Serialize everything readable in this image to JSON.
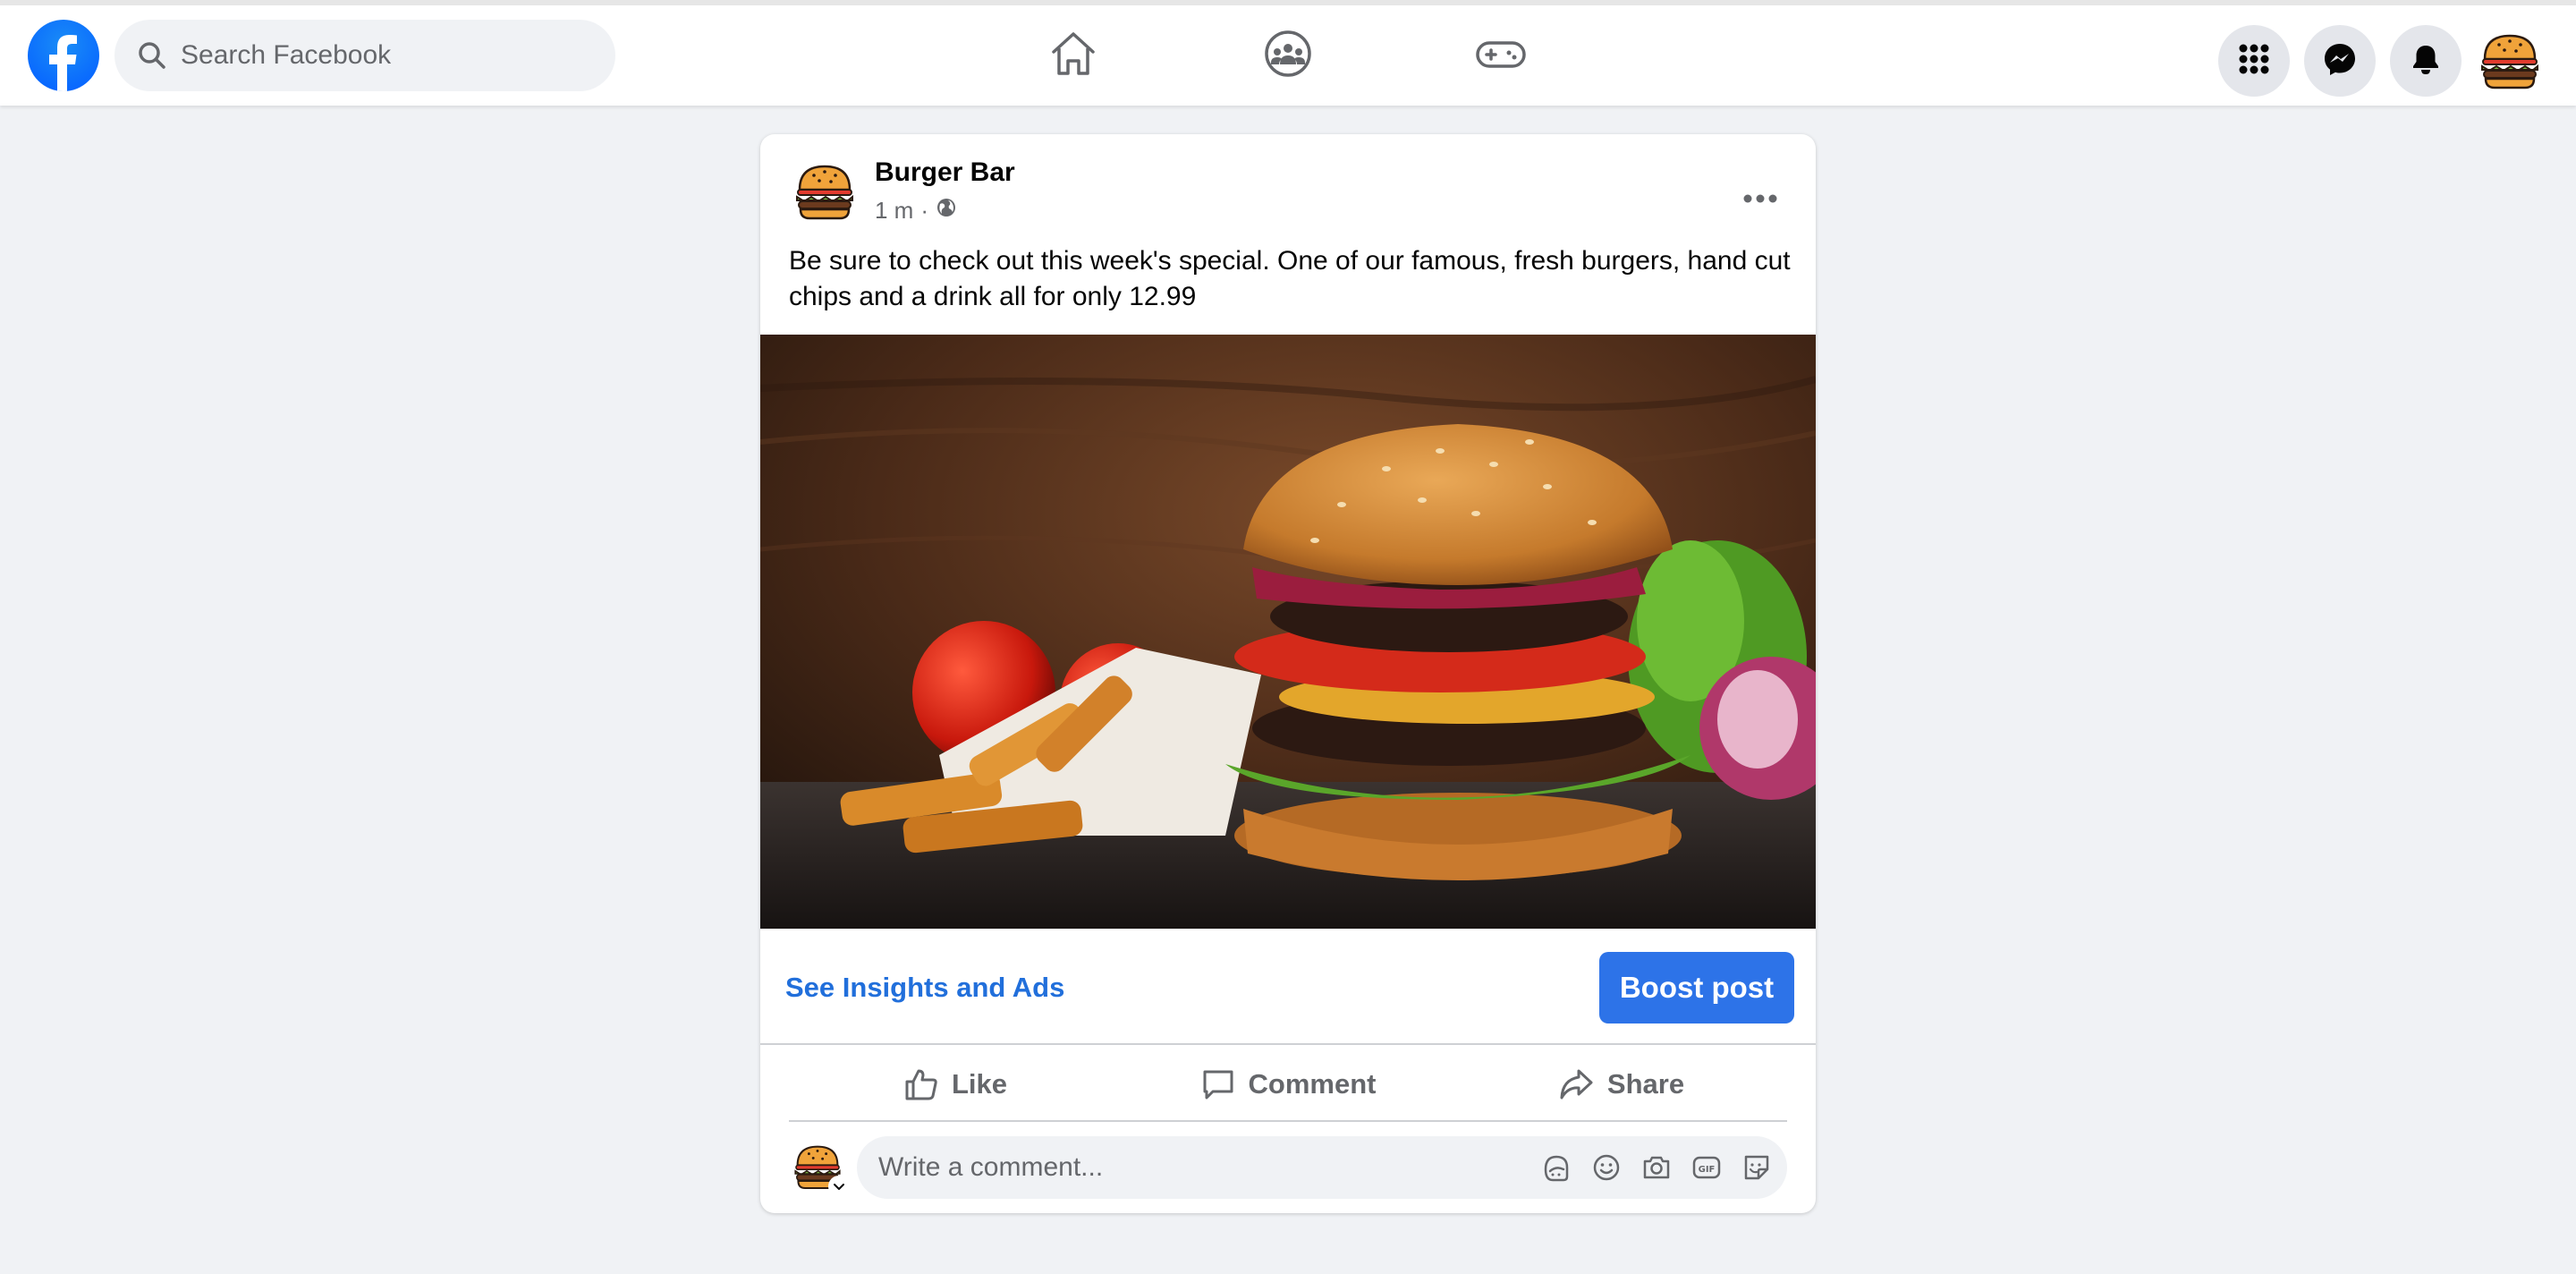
{
  "colors": {
    "facebook_blue": "#0866ff",
    "link_blue": "#216fdb",
    "boost_blue": "#2d73e8",
    "page_bg": "#f0f2f5",
    "secondary_text": "#65676b"
  },
  "header": {
    "logo_icon": "facebook-logo-icon",
    "search_placeholder": "Search Facebook",
    "nav_icons": [
      "home-icon",
      "groups-icon",
      "gaming-icon"
    ],
    "right_icons": [
      "menu-grid-icon",
      "messenger-icon",
      "notifications-bell-icon",
      "profile-avatar"
    ]
  },
  "post": {
    "author": "Burger Bar",
    "time": "1 m",
    "dot": "·",
    "privacy_icon": "globe-icon",
    "text": "Be sure to check out this week's special. One of our famous, fresh burgers, hand cut chips and a drink all for only 12.99",
    "insights_label": "See Insights and Ads",
    "boost_label": "Boost post",
    "actions": {
      "like": "Like",
      "comment": "Comment",
      "share": "Share"
    }
  },
  "comment": {
    "placeholder": "Write a comment...",
    "tool_icons": [
      "avatar-sticker-icon",
      "emoji-icon",
      "camera-icon",
      "gif-icon",
      "sticker-icon"
    ]
  }
}
